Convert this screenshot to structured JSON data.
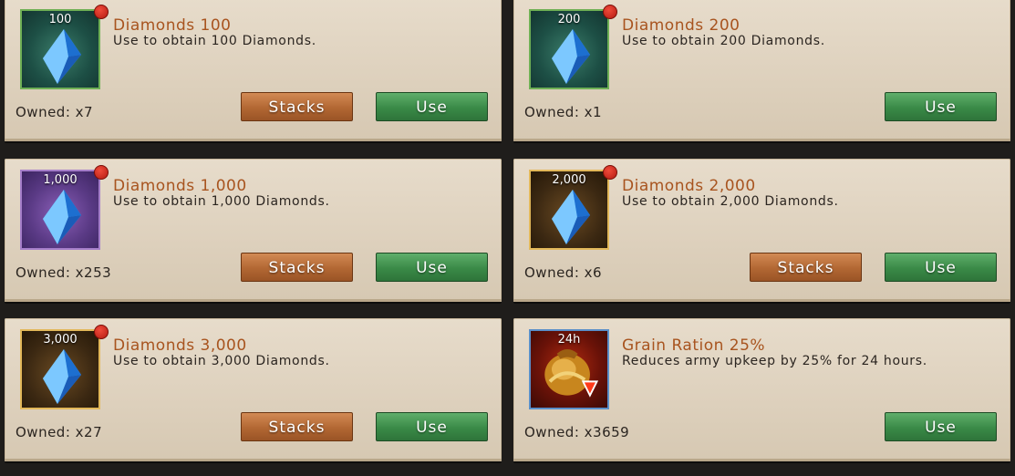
{
  "items": [
    {
      "amount_label": "100",
      "title": "Diamonds 100",
      "description": "Use to obtain 100 Diamonds.",
      "owned": "Owned: x7",
      "stacks_label": "Stacks",
      "use_label": "Use",
      "frame": "green",
      "icon": "blue-diamond-icon"
    },
    {
      "amount_label": "200",
      "title": "Diamonds 200",
      "description": "Use to obtain 200 Diamonds.",
      "owned": "Owned: x1",
      "stacks_label": "",
      "use_label": "Use",
      "frame": "green",
      "icon": "blue-diamond-icon"
    },
    {
      "amount_label": "1,000",
      "title": "Diamonds 1,000",
      "description": "Use to obtain 1,000 Diamonds.",
      "owned": "Owned: x253",
      "stacks_label": "Stacks",
      "use_label": "Use",
      "frame": "purple",
      "icon": "blue-diamond-icon"
    },
    {
      "amount_label": "2,000",
      "title": "Diamonds 2,000",
      "description": "Use to obtain 2,000 Diamonds.",
      "owned": "Owned: x6",
      "stacks_label": "Stacks",
      "use_label": "Use",
      "frame": "gold",
      "icon": "blue-diamond-icon"
    },
    {
      "amount_label": "3,000",
      "title": "Diamonds 3,000",
      "description": "Use to obtain 3,000 Diamonds.",
      "owned": "Owned: x27",
      "stacks_label": "Stacks",
      "use_label": "Use",
      "frame": "gold",
      "icon": "blue-diamond-icon"
    },
    {
      "amount_label": "24h",
      "title": "Grain Ration 25%",
      "description": "Reduces army upkeep by 25% for 24 hours.",
      "owned": "Owned: x3659",
      "stacks_label": "",
      "use_label": "Use",
      "frame": "red",
      "icon": "grain-sack-icon"
    }
  ],
  "colors": {
    "title": "#a8541f",
    "stacks_button": "#b26733",
    "use_button": "#3a8a47",
    "card_bg": "#ddd0bc",
    "badge": "#d62a1c"
  }
}
